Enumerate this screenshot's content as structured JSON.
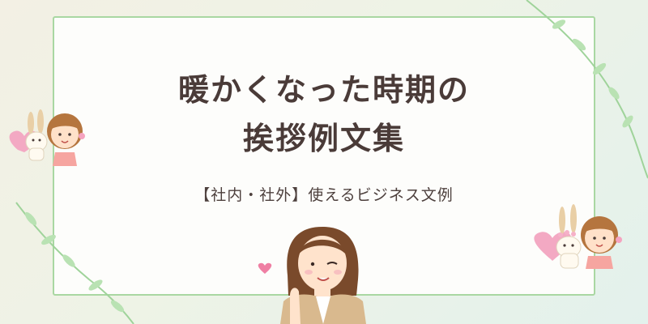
{
  "title": {
    "line1": "暖かくなった時期の",
    "line2": "挨拶例文集"
  },
  "subtitle": "【社内・社外】使えるビジネス文例",
  "colors": {
    "card_border": "#a9d7a2",
    "title_text": "#4a3b38",
    "leaf": "#8fcf8a",
    "heart": "#f2a3bd"
  },
  "icons": [
    "leaf-vine-icon",
    "girl-icon",
    "rabbit-icon",
    "heart-icon",
    "businesswoman-icon"
  ]
}
